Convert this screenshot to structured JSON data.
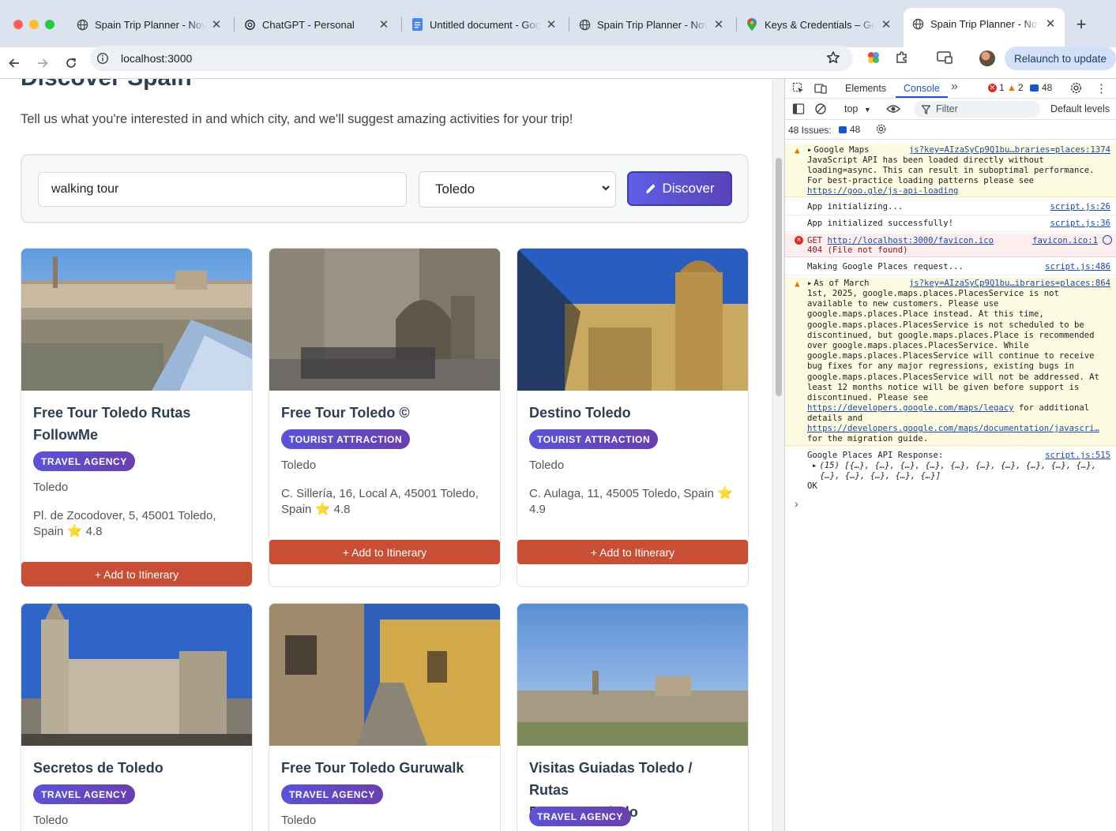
{
  "browser": {
    "tabs": [
      {
        "title": "Spain Trip Planner - Nov",
        "favicon": "globe-icon"
      },
      {
        "title": "ChatGPT - Personal",
        "favicon": "chatgpt-icon"
      },
      {
        "title": "Untitled document - Goo",
        "favicon": "docs-icon"
      },
      {
        "title": "Spain Trip Planner - Nov",
        "favicon": "globe-icon"
      },
      {
        "title": "Keys & Credentials – Goo",
        "favicon": "maps-pin-icon"
      },
      {
        "title": "Spain Trip Planner - Nov",
        "favicon": "globe-icon",
        "active": true
      }
    ],
    "new_tab": "+",
    "url": "localhost:3000",
    "relaunch_label": "Relaunch to update"
  },
  "page": {
    "heading": "Discover Spain",
    "intro": "Tell us what you're interested in and which city, and we'll suggest amazing activities for your trip!",
    "search": {
      "value": "walking tour",
      "city": "Toledo",
      "button": "Discover"
    },
    "add_label": "+ Add to Itinerary",
    "cards": [
      {
        "name_lines": [
          "Free Tour Toledo Rutas",
          "FollowMe"
        ],
        "badge": "TRAVEL AGENCY",
        "city": "Toledo",
        "addr_lines": [
          "Pl. de Zocodover, 5, 45001 Toledo,",
          "Spain"
        ],
        "rating": "4.8"
      },
      {
        "name_lines": [
          "Free Tour Toledo ©"
        ],
        "badge": "TOURIST ATTRACTION",
        "city": "Toledo",
        "addr_lines": [
          "C. Sillería, 16, Local A, 45001 Toledo,",
          "Spain"
        ],
        "rating": "4.8"
      },
      {
        "name_lines": [
          "Destino Toledo"
        ],
        "badge": "TOURIST ATTRACTION",
        "city": "Toledo",
        "addr_lines": [
          "C. Aulaga, 11, 45005 Toledo, Spain",
          ""
        ],
        "rating": "4.9"
      },
      {
        "name_lines": [
          "Secretos de Toledo"
        ],
        "badge": "TRAVEL AGENCY",
        "city": "Toledo"
      },
      {
        "name_lines": [
          "Free Tour Toledo Guruwalk"
        ],
        "badge": "TRAVEL AGENCY",
        "city": "Toledo"
      },
      {
        "name_lines": [
          "Visitas Guiadas Toledo / Rutas",
          "Pasearte Toledo"
        ],
        "badge": "TRAVEL AGENCY"
      }
    ]
  },
  "devtools": {
    "tabs": {
      "elements": "Elements",
      "console": "Console",
      "more": "»"
    },
    "counts": {
      "errors": "1",
      "warnings": "2",
      "messages": "48"
    },
    "context": "top",
    "filter_placeholder": "Filter",
    "levels": "Default levels",
    "issues_label": "48 Issues:",
    "issues_count": "48",
    "messages": {
      "m1_lead": "Google Maps",
      "m1_src": "js?key=AIzaSyCp9Q1bu…braries=places:1374",
      "m1_body": "JavaScript API has been loaded directly without\nloading=async. This can result in suboptimal performance.\nFor best-practice loading patterns please see",
      "m1_link": "https://goo.gle/js-api-loading",
      "m2_text": "App initializing...",
      "m2_src": "script.js:26",
      "m3_text": "App initialized successfully!",
      "m3_src": "script.js:36",
      "m4_get": "GET",
      "m4_url": "http://localhost:3000/favicon.ico",
      "m4_src": "favicon.ico:1",
      "m4_status": "404 (File not found)",
      "m5_text": "Making Google Places request...",
      "m5_src": "script.js:486",
      "m6_lead": "As of March",
      "m6_src": "js?key=AIzaSyCp9Q1bu…ibraries=places:864",
      "m6_body": "1st, 2025, google.maps.places.PlacesService is not\navailable to new customers. Please use\ngoogle.maps.places.Place instead. At this time,\ngoogle.maps.places.PlacesService is not scheduled to be\ndiscontinued, but google.maps.places.Place is recommended\nover google.maps.places.PlacesService. While\ngoogle.maps.places.PlacesService will continue to receive\nbug fixes for any major regressions, existing bugs in\ngoogle.maps.places.PlacesService will not be addressed. At\nleast 12 months notice will be given before support is\ndiscontinued. Please see",
      "m6_link1": "https://developers.google.com/maps/legacy",
      "m6_link1_tail": " for additional",
      "m6_mid": "details and",
      "m6_link2": "https://developers.google.com/maps/documentation/javascri…",
      "m6_tail": "for the migration guide.",
      "m7_text": "Google Places API Response:",
      "m7_src": "script.js:515",
      "m7_arr1": "(15) [{…}, {…}, {…}, {…}, {…}, {…}, {…}, {…}, {…}, {…},",
      "m7_arr2": "{…}, {…}, {…}, {…}, {…}]",
      "m7_ok": "OK",
      "prompt": "›"
    }
  },
  "colors": {
    "accent": "#5a4fd6",
    "add_button": "#c94e36",
    "warning_bg": "#fefbe3",
    "error_bg": "#fcedee"
  }
}
